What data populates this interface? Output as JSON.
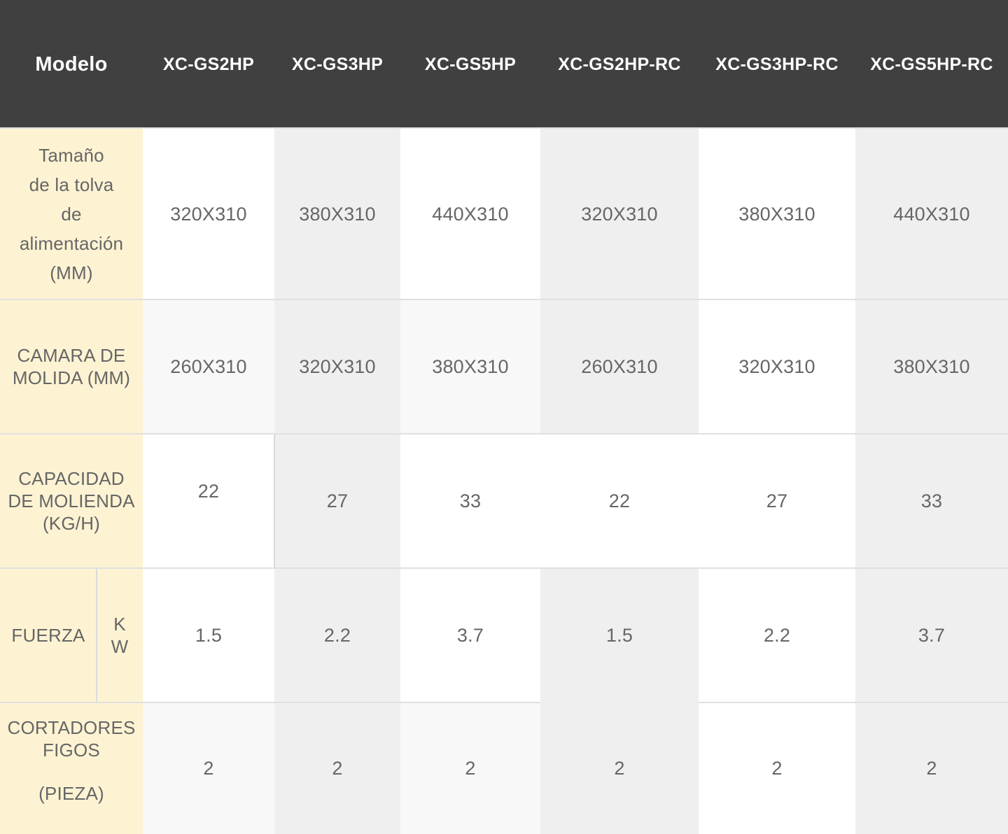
{
  "header": {
    "model_label": "Modelo",
    "models": [
      "XC-GS2HP",
      "XC-GS3HP",
      "XC-GS5HP",
      "XC-GS2HP-RC",
      "XC-GS3HP-RC",
      "XC-GS5HP-RC"
    ]
  },
  "rows": [
    {
      "label_lines": [
        "Tamaño",
        "de la tolva",
        "de",
        "alimentación",
        "(MM)"
      ],
      "values": [
        "320X310",
        "380X310",
        "440X310",
        "320X310",
        "380X310",
        "440X310"
      ]
    },
    {
      "label_lines": [
        "CAMARA DE",
        "MOLIDA (MM)"
      ],
      "values": [
        "260X310",
        "320X310",
        "380X310",
        "260X310",
        "320X310",
        "380X310"
      ]
    },
    {
      "label_lines": [
        "CAPACIDAD",
        "DE MOLIENDA",
        "(KG/H)"
      ],
      "values": [
        "22",
        "27",
        "33",
        "22",
        "27",
        "33"
      ]
    },
    {
      "label": "FUERZA",
      "unit_lines": [
        "K",
        "W"
      ],
      "values": [
        "1.5",
        "2.2",
        "3.7",
        "1.5",
        "2.2",
        "3.7"
      ]
    },
    {
      "label_lines": [
        "CORTADORES",
        "FIGOS"
      ],
      "label_suffix": "(PIEZA)",
      "values": [
        "2",
        "2",
        "2",
        "2",
        "2",
        "2"
      ]
    }
  ]
}
